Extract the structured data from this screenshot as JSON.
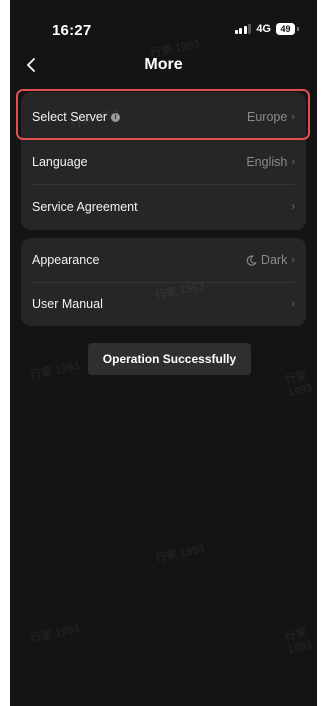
{
  "status_bar": {
    "time": "16:27",
    "network": "4G",
    "battery": "49"
  },
  "header": {
    "title": "More",
    "back_icon": "chevron-left-icon"
  },
  "settings_group_1": [
    {
      "label": "Select Server",
      "value": "Europe",
      "has_info_icon": true
    },
    {
      "label": "Language",
      "value": "English"
    },
    {
      "label": "Service Agreement",
      "value": ""
    }
  ],
  "settings_group_2": [
    {
      "label": "Appearance",
      "value": "Dark",
      "icon": "moon-icon"
    },
    {
      "label": "User Manual",
      "value": ""
    }
  ],
  "toast": {
    "message": "Operation Successfully"
  },
  "watermark": "行家 1993",
  "colors": {
    "background": "#141414",
    "card": "#262626",
    "highlight": "#e0504e",
    "toast": "#2f2f2f"
  }
}
